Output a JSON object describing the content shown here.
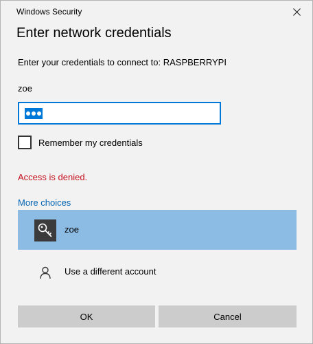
{
  "window": {
    "title": "Windows Security"
  },
  "dialog": {
    "heading": "Enter network credentials",
    "prompt": "Enter your credentials to connect to: RASPBERRYPI",
    "username": "zoe",
    "password_masked": "•••",
    "remember_label": "Remember my credentials",
    "remember_checked": false,
    "error": "Access is denied.",
    "more_choices": "More choices",
    "choices": [
      {
        "label": "zoe",
        "icon": "key-icon",
        "selected": true
      },
      {
        "label": "Use a different account",
        "icon": "person-icon",
        "selected": false
      }
    ],
    "ok_label": "OK",
    "cancel_label": "Cancel"
  },
  "colors": {
    "accent": "#0078d7",
    "selection": "#8cbbe3",
    "error": "#c50f1f",
    "link": "#0063b1"
  }
}
